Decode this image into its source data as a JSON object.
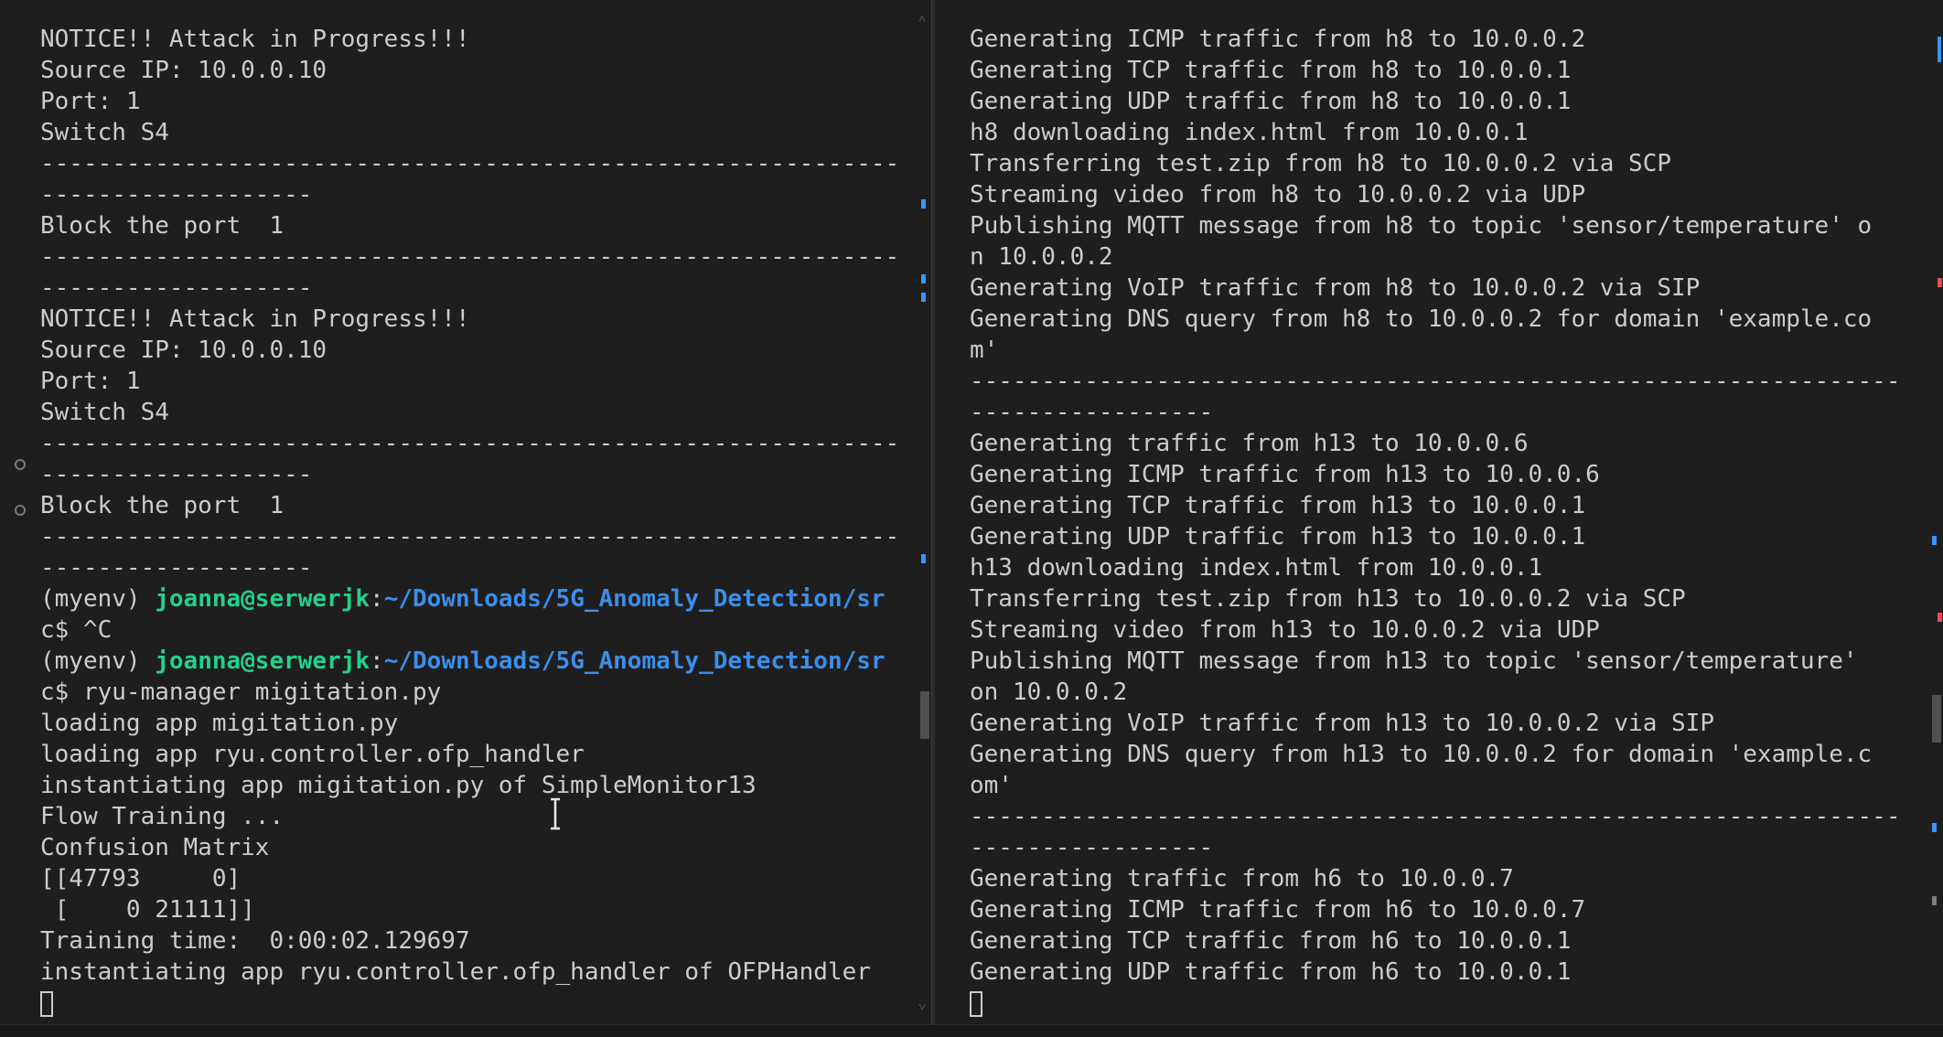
{
  "left_terminal": {
    "lines": [
      {
        "text": "NOTICE!! Attack in Progress!!!"
      },
      {
        "text": "Source IP: 10.0.0.10"
      },
      {
        "text": "Port: 1"
      },
      {
        "text": "Switch S4"
      },
      {
        "text": "------------------------------------------------------------"
      },
      {
        "text": "-------------------"
      },
      {
        "text": "Block the port  1"
      },
      {
        "text": "------------------------------------------------------------"
      },
      {
        "text": "-------------------"
      },
      {
        "text": "NOTICE!! Attack in Progress!!!"
      },
      {
        "text": "Source IP: 10.0.0.10"
      },
      {
        "text": "Port: 1"
      },
      {
        "text": "Switch S4"
      },
      {
        "text": "------------------------------------------------------------"
      },
      {
        "text": "-------------------"
      },
      {
        "text": "Block the port  1"
      },
      {
        "text": "------------------------------------------------------------"
      },
      {
        "text": "-------------------"
      },
      {
        "prompt": true,
        "env": "(myenv) ",
        "user": "joanna@serwerjk",
        "sep": ":",
        "path": "~/Downloads/5G_Anomaly_Detection/sr"
      },
      {
        "text": "c$ ^C"
      },
      {
        "prompt": true,
        "env": "(myenv) ",
        "user": "joanna@serwerjk",
        "sep": ":",
        "path": "~/Downloads/5G_Anomaly_Detection/sr"
      },
      {
        "text": "c$ ryu-manager migitation.py"
      },
      {
        "text": "loading app migitation.py"
      },
      {
        "text": "loading app ryu.controller.ofp_handler"
      },
      {
        "text": "instantiating app migitation.py of SimpleMonitor13"
      },
      {
        "text": "Flow Training ..."
      },
      {
        "text": "Confusion Matrix"
      },
      {
        "text": "[[47793     0]"
      },
      {
        "text": " [    0 21111]]"
      },
      {
        "text": "Training time:  0:00:02.129697"
      },
      {
        "text": "instantiating app ryu.controller.ofp_handler of OFPHandler"
      },
      {
        "cursor": true
      }
    ]
  },
  "right_terminal": {
    "lines": [
      {
        "text": "Generating ICMP traffic from h8 to 10.0.0.2"
      },
      {
        "text": "Generating TCP traffic from h8 to 10.0.0.1"
      },
      {
        "text": "Generating UDP traffic from h8 to 10.0.0.1"
      },
      {
        "text": "h8 downloading index.html from 10.0.0.1"
      },
      {
        "text": "Transferring test.zip from h8 to 10.0.0.2 via SCP"
      },
      {
        "text": "Streaming video from h8 to 10.0.0.2 via UDP"
      },
      {
        "text": "Publishing MQTT message from h8 to topic 'sensor/temperature' o"
      },
      {
        "text": "n 10.0.0.2"
      },
      {
        "text": "Generating VoIP traffic from h8 to 10.0.0.2 via SIP"
      },
      {
        "text": "Generating DNS query from h8 to 10.0.0.2 for domain 'example.co"
      },
      {
        "text": "m'"
      },
      {
        "text": "-----------------------------------------------------------------"
      },
      {
        "text": "-----------------"
      },
      {
        "text": "Generating traffic from h13 to 10.0.0.6"
      },
      {
        "text": "Generating ICMP traffic from h13 to 10.0.0.6"
      },
      {
        "text": "Generating TCP traffic from h13 to 10.0.0.1"
      },
      {
        "text": "Generating UDP traffic from h13 to 10.0.0.1"
      },
      {
        "text": "h13 downloading index.html from 10.0.0.1"
      },
      {
        "text": "Transferring test.zip from h13 to 10.0.0.2 via SCP"
      },
      {
        "text": "Streaming video from h13 to 10.0.0.2 via UDP"
      },
      {
        "text": "Publishing MQTT message from h13 to topic 'sensor/temperature'"
      },
      {
        "text": "on 10.0.0.2"
      },
      {
        "text": "Generating VoIP traffic from h13 to 10.0.0.2 via SIP"
      },
      {
        "text": "Generating DNS query from h13 to 10.0.0.2 for domain 'example.c"
      },
      {
        "text": "om'"
      },
      {
        "text": "-----------------------------------------------------------------"
      },
      {
        "text": "-----------------"
      },
      {
        "text": "Generating traffic from h6 to 10.0.0.7"
      },
      {
        "text": "Generating ICMP traffic from h6 to 10.0.0.7"
      },
      {
        "text": "Generating TCP traffic from h6 to 10.0.0.1"
      },
      {
        "text": "Generating UDP traffic from h6 to 10.0.0.1"
      },
      {
        "cursor": true
      }
    ]
  },
  "colors": {
    "background": "#1e1e1e",
    "text": "#cccccc",
    "user": "#23d18b",
    "path": "#3b8eea",
    "scroll_mark_blue": "#3794ff",
    "scroll_mark_red": "#f14c4c",
    "scroll_mark_gray": "#808080"
  }
}
